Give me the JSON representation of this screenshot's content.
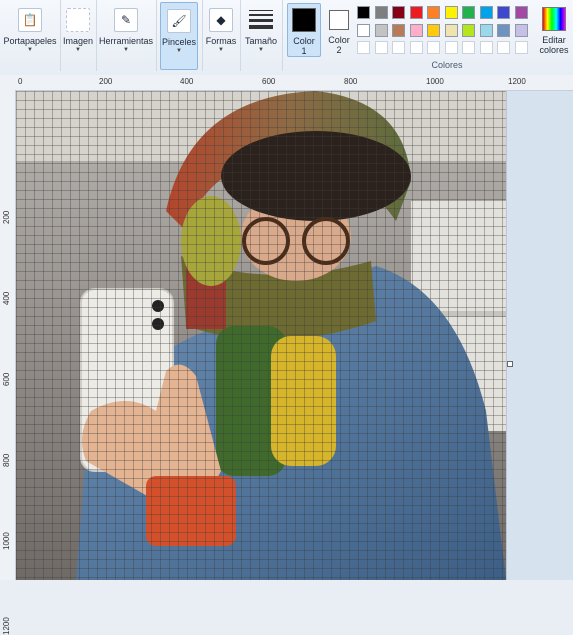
{
  "toolbar": {
    "portapapeles": "Portapapeles",
    "imagen": "Imagen",
    "herramientas": "Herramientas",
    "pinceles": "Pinceles",
    "formas": "Formas",
    "tamano": "Tamaño",
    "color1": "Color 1",
    "color1_line1": "Color",
    "color1_line2": "1",
    "color2_line1": "Color",
    "color2_line2": "2",
    "editar_line1": "Editar",
    "editar_line2": "colores",
    "colores": "Colores"
  },
  "colors": {
    "color1": "#000000",
    "color2": "#ffffff",
    "palette_row1": [
      "#000000",
      "#7f7f7f",
      "#880015",
      "#ed1c24",
      "#ff7f27",
      "#fff200",
      "#22b14c",
      "#00a2e8",
      "#3f48cc",
      "#a349a4"
    ],
    "palette_row2": [
      "#ffffff",
      "#c3c3c3",
      "#b97a57",
      "#ffaec9",
      "#ffc90e",
      "#efe4b0",
      "#b5e61d",
      "#99d9ea",
      "#7092be",
      "#c8bfe7"
    ]
  },
  "rulers": {
    "top": [
      "0",
      "200",
      "400",
      "600",
      "800",
      "1000",
      "1200"
    ],
    "left": [
      "200",
      "400",
      "600",
      "800",
      "1000",
      "1200"
    ]
  }
}
